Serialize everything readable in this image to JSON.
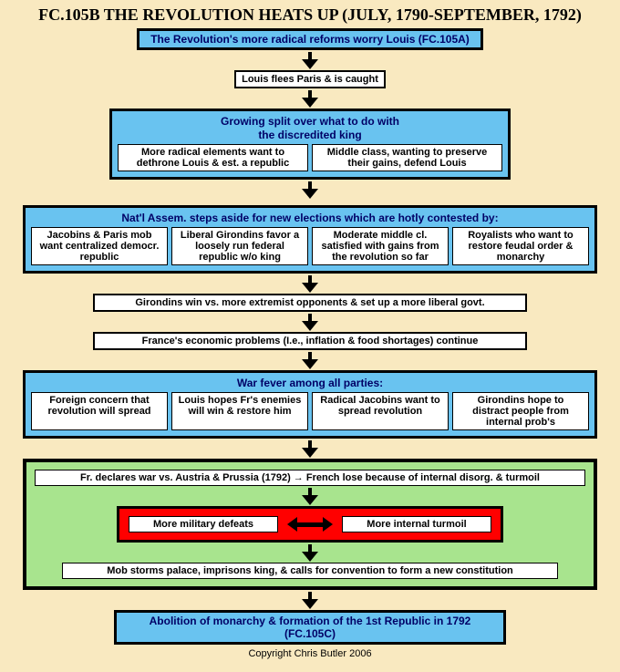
{
  "title": "FC.105B THE REVOLUTION HEATS UP (JULY, 1790-SEPTEMBER, 1792)",
  "top_link": "The Revolution's more radical reforms worry Louis (FC.105A)",
  "step_flees": "Louis flees Paris & is caught",
  "split": {
    "head1": "Growing split over what to do with",
    "head2": "the discredited king",
    "left": "More radical elements want to dethrone Louis & est. a republic",
    "right": "Middle class, wanting to preserve their gains, defend Louis"
  },
  "elections": {
    "head": "Nat'l Assem. steps aside for new elections which are hotly contested by:",
    "c1": "Jacobins & Paris mob want centralized democr. republic",
    "c2": "Liberal Girondins favor a loosely run federal republic w/o king",
    "c3": "Moderate middle cl. satisfied with gains from the revolution so far",
    "c4": "Royalists who want to restore feudal order & monarchy"
  },
  "girondins_win": "Girondins win vs. more extremist opponents & set up a more liberal govt.",
  "economy": "France's economic problems (I.e., inflation & food shortages) continue",
  "war_fever": {
    "head": "War fever among all parties:",
    "c1": "Foreign concern that revolution will spread",
    "c2": "Louis hopes Fr's enemies will win & restore him",
    "c3": "Radical Jacobins want to spread revolution",
    "c4": "Girondins hope to distract people from internal prob's"
  },
  "war": {
    "declare": "Fr. declares war vs. Austria & Prussia (1792) → French lose because of internal disorg. & turmoil",
    "defeats": "More military defeats",
    "turmoil": "More internal turmoil",
    "mob": "Mob storms palace,  imprisons king, & calls for convention to form a new constitution"
  },
  "bottom_link": "Abolition of monarchy & formation of the 1st Republic in 1792 (FC.105C)",
  "copyright": "Copyright Chris Butler 2006"
}
